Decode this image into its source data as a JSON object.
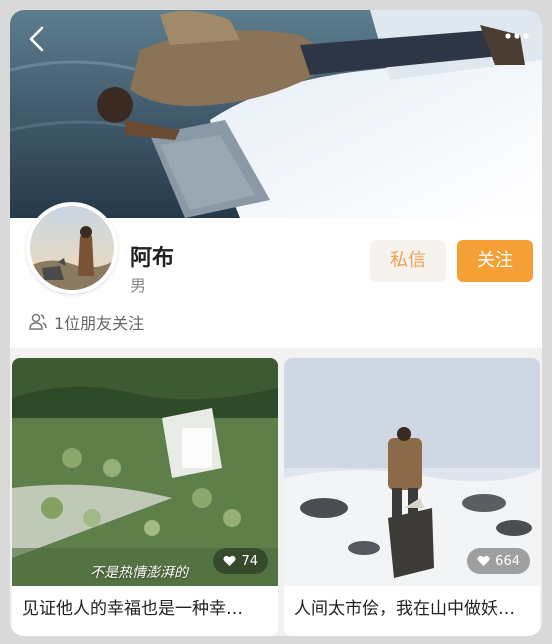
{
  "profile": {
    "name": "阿布",
    "gender": "男",
    "followers_text": "1位朋友关注",
    "message_label": "私信",
    "follow_label": "关注"
  },
  "posts": [
    {
      "title": "见证他人的幸福也是一种幸…",
      "likes": "74",
      "overlay_text": "不是热情澎湃的"
    },
    {
      "title": "人间太市侩，我在山中做妖…",
      "likes": "664"
    }
  ],
  "colors": {
    "accent": "#f5a037",
    "message_text": "#e8a255"
  },
  "icons": [
    "back-icon",
    "more-icon",
    "friends-icon",
    "heart-icon"
  ]
}
